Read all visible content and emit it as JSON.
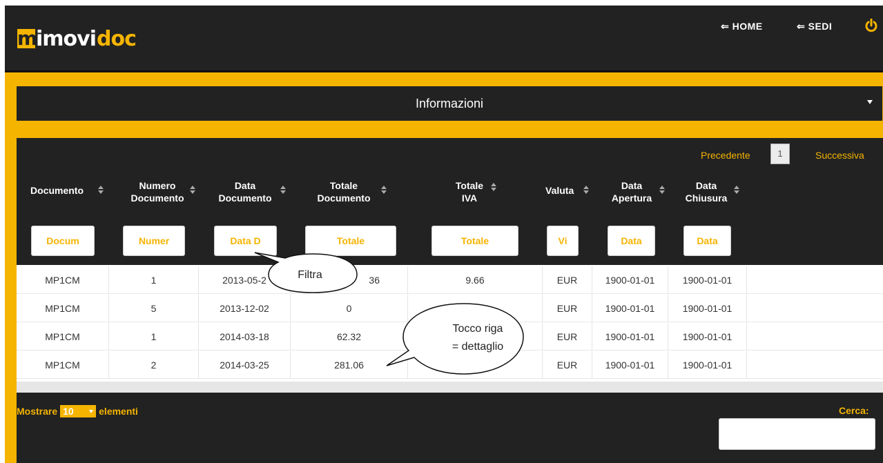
{
  "header": {
    "logo": {
      "mark": "m",
      "part1": "imovi",
      "part2": "doc"
    },
    "nav": [
      {
        "label": "⇐ HOME"
      },
      {
        "label": "⇐ SEDI"
      }
    ],
    "power_icon": "power-icon"
  },
  "info": {
    "title": "Informazioni"
  },
  "pager": {
    "prev": "Precedente",
    "page": "1",
    "next": "Successiva"
  },
  "table": {
    "columns": [
      {
        "label": "Documento",
        "filter": "Docum"
      },
      {
        "label": "Numero Documento",
        "filter": "Numer"
      },
      {
        "label": "Data Documento",
        "filter": "Data D"
      },
      {
        "label": "Totale Documento",
        "filter": "Totale"
      },
      {
        "label": "Totale IVA",
        "filter": "Totale"
      },
      {
        "label": "Valuta",
        "filter": "Vi"
      },
      {
        "label": "Data Apertura",
        "filter": "Data"
      },
      {
        "label": "Data Chiusura",
        "filter": "Data"
      }
    ],
    "rows": [
      [
        "MP1CM",
        "1",
        "2013-05-2",
        "36",
        "9.66",
        "EUR",
        "1900-01-01",
        "1900-01-01"
      ],
      [
        "MP1CM",
        "5",
        "2013-12-02",
        "0",
        "",
        "EUR",
        "1900-01-01",
        "1900-01-01"
      ],
      [
        "MP1CM",
        "1",
        "2014-03-18",
        "62.32",
        "",
        "EUR",
        "1900-01-01",
        "1900-01-01"
      ],
      [
        "MP1CM",
        "2",
        "2014-03-25",
        "281.06",
        "",
        "EUR",
        "1900-01-01",
        "1900-01-01"
      ]
    ]
  },
  "footer": {
    "show_label": "Mostrare",
    "show_value": "10",
    "show_suffix": "elementi",
    "search_label": "Cerca:",
    "search_value": ""
  },
  "annotations": {
    "filter_callout": "Filtra",
    "row_callout_line1": "Tocco riga",
    "row_callout_line2": "= dettaglio"
  },
  "colors": {
    "accent": "#f5b400",
    "dark": "#222222"
  }
}
